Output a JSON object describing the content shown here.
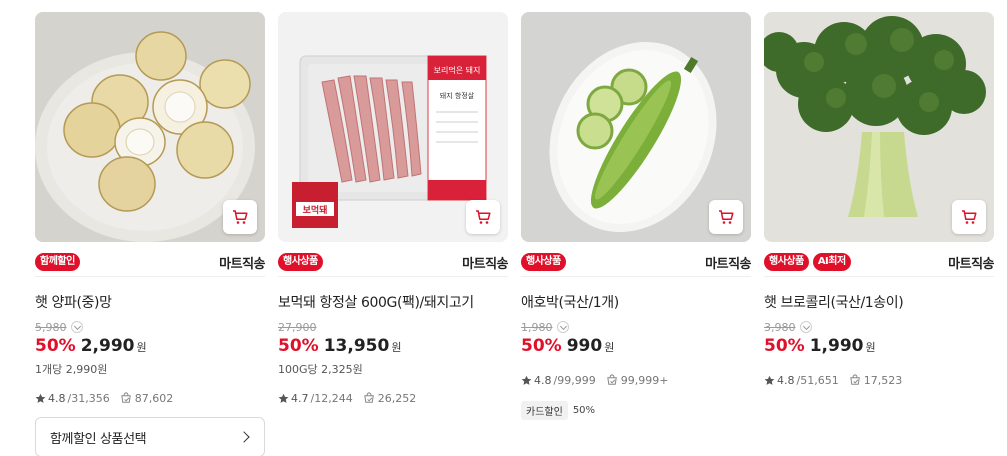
{
  "products": [
    {
      "name": "햇 양파(중)망",
      "badges": [
        "함께할인"
      ],
      "delivery": "마트직송",
      "original_price": "5,980",
      "discount_rate": "50%",
      "price": "2,990",
      "currency": "원",
      "unit_price": "1개당 2,990원",
      "rating": "4.8",
      "review_count": "/31,356",
      "purchase_count": "87,602",
      "card_sale": null,
      "bundle_button": "함께할인 상품선택"
    },
    {
      "name": "보먹돼 항정살 600G(팩)/돼지고기",
      "badges": [
        "행사상품"
      ],
      "delivery": "마트직송",
      "original_price": "27,900",
      "discount_rate": "50%",
      "price": "13,950",
      "currency": "원",
      "unit_price": "100G당 2,325원",
      "rating": "4.7",
      "review_count": "/12,244",
      "purchase_count": "26,252",
      "card_sale": null,
      "bundle_button": null,
      "package_labels": {
        "brand": "보리먹은 돼지",
        "cut": "돼지 항정살",
        "sticker": "보먹돼"
      }
    },
    {
      "name": "애호박(국산/1개)",
      "badges": [
        "행사상품"
      ],
      "delivery": "마트직송",
      "original_price": "1,980",
      "discount_rate": "50%",
      "price": "990",
      "currency": "원",
      "unit_price": "",
      "rating": "4.8",
      "review_count": "/99,999",
      "purchase_count": "99,999+",
      "card_sale": {
        "label": "카드할인",
        "rate": "50%"
      },
      "bundle_button": null
    },
    {
      "name": "햇 브로콜리(국산/1송이)",
      "badges": [
        "행사상품",
        "AI최저"
      ],
      "delivery": "마트직송",
      "original_price": "3,980",
      "discount_rate": "50%",
      "price": "1,990",
      "currency": "원",
      "unit_price": "",
      "rating": "4.8",
      "review_count": "/51,651",
      "purchase_count": "17,523",
      "card_sale": null,
      "bundle_button": null
    }
  ],
  "icons": {
    "cart": "cart-icon",
    "star": "star-icon",
    "purchase": "purchase-count-icon",
    "chevron": "chevron-down-icon"
  },
  "colors": {
    "accent_red": "#e0102a",
    "text": "#222222",
    "muted": "#9a9a9a"
  }
}
